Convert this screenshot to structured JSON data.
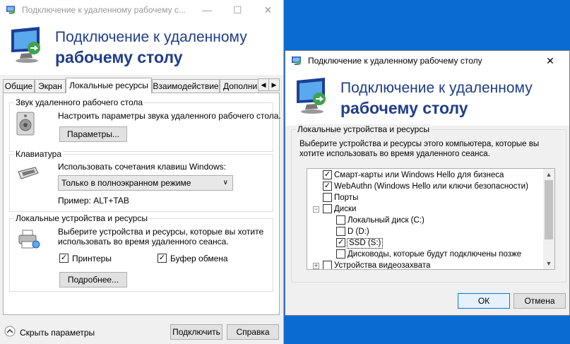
{
  "main_window": {
    "title": "Подключение к удаленному рабочему с...",
    "controls": {
      "minimize": "—",
      "maximize": "☐",
      "close": "✕"
    },
    "banner": {
      "line1": "Подключение к удаленному",
      "line2": "рабочему столу"
    },
    "tabs": [
      "Общие",
      "Экран",
      "Локальные ресурсы",
      "Взаимодействие",
      "Дополни"
    ],
    "active_tab": "Локальные ресурсы",
    "sound": {
      "legend": "Звук удаленного рабочего стола",
      "description": "Настроить параметры звука удаленного рабочего стола.",
      "button": "Параметры..."
    },
    "keyboard": {
      "legend": "Клавиатура",
      "label": "Использовать сочетания клавиш Windows:",
      "selected": "Только в полноэкранном режиме",
      "example": "Пример: ALT+TAB"
    },
    "local_devices": {
      "legend": "Локальные устройства и ресурсы",
      "description_line1": "Выберите устройства и ресурсы, которые вы хотите",
      "description_line2": "использовать во время удаленного сеанса.",
      "printers_label": "Принтеры",
      "printers_checked": true,
      "clipboard_label": "Буфер обмена",
      "clipboard_checked": true,
      "more_button": "Подробнее..."
    },
    "footer": {
      "hide_options": "Скрыть параметры",
      "connect": "Подключить",
      "help": "Справка"
    }
  },
  "devices_dialog": {
    "title": "Подключение к удаленному рабочему столу",
    "close": "✕",
    "banner": {
      "line1": "Подключение к удаленному",
      "line2": "рабочему столу"
    },
    "group_legend": "Локальные устройства и ресурсы",
    "description_line1": "Выберите устройства и ресурсы этого компьютера, которые вы",
    "description_line2": "хотите использовать во время удаленного сеанса.",
    "tree": [
      {
        "label": "Смарт-карты или Windows Hello для бизнеса",
        "checked": true,
        "level": 0
      },
      {
        "label": "WebAuthn (Windows Hello или ключи безопасности)",
        "checked": true,
        "level": 0
      },
      {
        "label": "Порты",
        "checked": false,
        "level": 0
      },
      {
        "label": "Диски",
        "checked": false,
        "level": 0,
        "expander": "−"
      },
      {
        "label": "Локальный диск (C:)",
        "checked": false,
        "level": 1
      },
      {
        "label": "D (D:)",
        "checked": false,
        "level": 1
      },
      {
        "label": "SSD (S:)",
        "checked": true,
        "level": 1,
        "selected": true
      },
      {
        "label": "Дисководы, которые будут подключены позже",
        "checked": false,
        "level": 1
      },
      {
        "label": "Устройства видеозахвата",
        "checked": false,
        "level": 0,
        "expander": "+"
      }
    ],
    "ok": "ОК",
    "cancel": "Отмена"
  }
}
